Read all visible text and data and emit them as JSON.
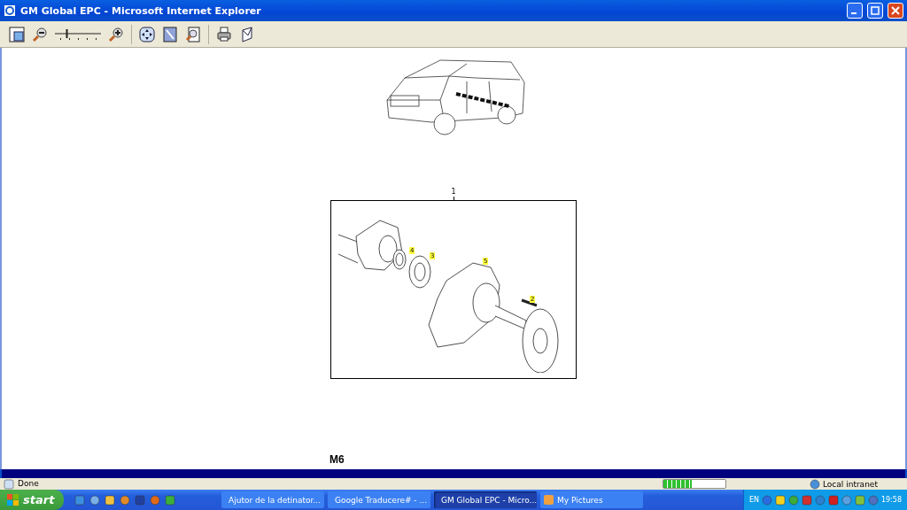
{
  "window": {
    "title": "GM Global EPC - Microsoft Internet Explorer"
  },
  "toolbar": {
    "zoom": {
      "level": 0.25
    }
  },
  "diagram": {
    "assembly_label": "1",
    "callouts": [
      "4",
      "3",
      "5",
      "2"
    ],
    "page_label": "M6"
  },
  "status_bar": {
    "text": "Done",
    "progress": {
      "level": 0.45
    },
    "zone": "Local intranet"
  },
  "taskbar": {
    "start": "start",
    "tasks": [
      {
        "label": "Ajutor de la detinator...",
        "selected": false
      },
      {
        "label": "Google Traducere# - ...",
        "selected": false
      },
      {
        "label": "GM Global EPC - Micro...",
        "selected": true
      },
      {
        "label": "My Pictures",
        "selected": false
      }
    ],
    "language": "EN",
    "clock": "19:58"
  }
}
